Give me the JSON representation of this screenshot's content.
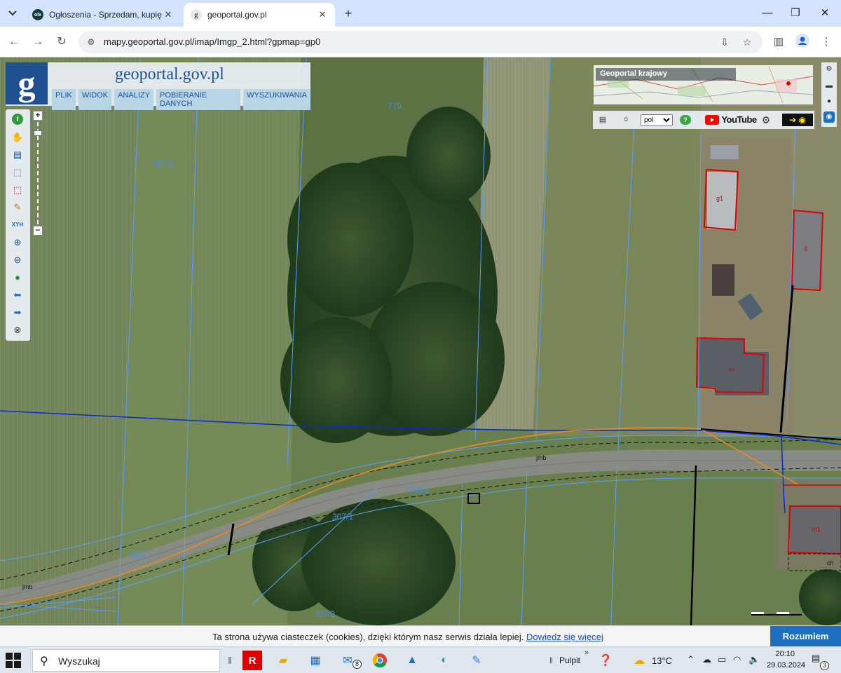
{
  "browser": {
    "tabs": [
      {
        "title": "Ogłoszenia - Sprzedam, kupię n",
        "favicon": "olx-icon",
        "active": false
      },
      {
        "title": "geoportal.gov.pl",
        "favicon": "geoportal-icon",
        "active": true
      }
    ],
    "url": "mapy.geoportal.gov.pl/imap/Imgp_2.html?gpmap=gp0"
  },
  "geoportal": {
    "logo_letter": "g",
    "title": "geoportal.gov.pl",
    "menu": [
      "PLIK",
      "WIDOK",
      "ANALIZY",
      "POBIERANIE DANYCH",
      "WYSZUKIWANIA"
    ],
    "tools": [
      "info-icon",
      "pan-hand-icon",
      "legend-list-icon",
      "select-blue-icon",
      "select-red-icon",
      "pencil-icon",
      "xyz-coordinates-icon",
      "zoom-in-icon",
      "zoom-out-icon",
      "globe-extent-icon",
      "back-arrow-icon",
      "forward-arrow-icon",
      "clear-icon"
    ],
    "xyz_label": "XYH",
    "overview_title": "Geoportal krajowy",
    "language": "pol",
    "youtube_label": "YouTube",
    "zoom_plus": "+",
    "zoom_minus": "−"
  },
  "map": {
    "parcels": [
      "779",
      "807/2",
      "308/1",
      "307/1",
      "307/2",
      "38/2"
    ],
    "buildings": [
      "g1",
      "ll",
      "m1",
      "m",
      "ch"
    ],
    "road_labels": [
      "jmb",
      "jmb"
    ]
  },
  "cookie": {
    "message": "Ta strona używa ciasteczek (cookies), dzięki którym nasz serwis działa lepiej.",
    "link": "Dowiedz się więcej",
    "button": "Rozumiem"
  },
  "taskbar": {
    "search_placeholder": "Wyszukaj",
    "mail_badge": "8",
    "pulpit": "Pulpit",
    "weather": "13°C",
    "time": "20:10",
    "date": "29.03.2024",
    "notifications": "3"
  },
  "colors": {
    "tab_strip": "#d3e3fd",
    "geoportal_blue": "#1d4f91",
    "parcel_line": "#5aa0ff",
    "utility_blue": "#0a28d8",
    "utility_orange": "#f08a1c",
    "building_red": "#e00000",
    "accept_button": "#1d6fc2"
  }
}
